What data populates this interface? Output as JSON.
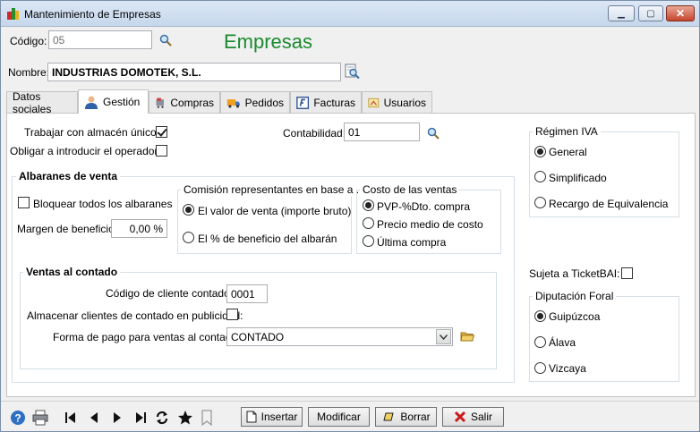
{
  "window": {
    "title": "Mantenimiento de Empresas",
    "minimize": "▁",
    "maximize": "▢",
    "close": "✕"
  },
  "header": {
    "codigo_label": "Código:",
    "codigo_value": "05",
    "page_title": "Empresas",
    "nombre_label": "Nombre:",
    "nombre_value": "INDUSTRIAS DOMOTEK, S.L."
  },
  "tabs": [
    {
      "label": "Datos sociales",
      "icon": "none"
    },
    {
      "label": "Gestión",
      "icon": "user-icon",
      "active": true
    },
    {
      "label": "Compras",
      "icon": "cart-icon"
    },
    {
      "label": "Pedidos",
      "icon": "truck-icon"
    },
    {
      "label": "Facturas",
      "icon": "invoice-icon"
    },
    {
      "label": "Usuarios",
      "icon": "users-icon"
    }
  ],
  "gestion": {
    "almacen_label": "Trabajar con almacén único:",
    "almacen_checked": true,
    "operador_label": "Obligar a introducir el operador:",
    "operador_checked": false,
    "contabilidad_label": "Contabilidad:",
    "contabilidad_value": "01",
    "albaranes": {
      "title": "Albaranes de venta",
      "bloquear_label": "Bloquear todos los albaranes",
      "bloquear_checked": false,
      "margen_label": "Margen de beneficio:",
      "margen_value": "0,00 %",
      "comision": {
        "title": "Comisión representantes en base a ...",
        "options": [
          "El valor de venta (importe bruto)",
          "El % de beneficio del albarán"
        ],
        "selected": 0
      },
      "costo": {
        "title": "Costo de las ventas",
        "options": [
          "PVP-%Dto. compra",
          "Precio medio de costo",
          "Última compra"
        ],
        "selected": 0
      }
    },
    "contado": {
      "title": "Ventas al contado",
      "cliente_label": "Código de cliente contado:",
      "cliente_value": "0001",
      "almacenar_label": "Almacenar clientes de contado en publicidad:",
      "almacenar_checked": false,
      "forma_pago_label": "Forma de pago para ventas al contado:",
      "forma_pago_value": "CONTADO"
    },
    "regimen": {
      "title": "Régimen IVA",
      "options": [
        "General",
        "Simplificado",
        "Recargo de Equivalencia"
      ],
      "selected": 0
    },
    "ticketbai_label": "Sujeta a TicketBAI:",
    "ticketbai_checked": false,
    "diputacion": {
      "title": "Diputación Foral",
      "options": [
        "Guipúzcoa",
        "Álava",
        "Vizcaya"
      ],
      "selected": 0
    }
  },
  "footer": {
    "insertar": "Insertar",
    "modificar": "Modificar",
    "borrar": "Borrar",
    "salir": "Salir"
  },
  "colors": {
    "title_green": "#1b8a2f",
    "salir_red": "#cc1a1a"
  }
}
